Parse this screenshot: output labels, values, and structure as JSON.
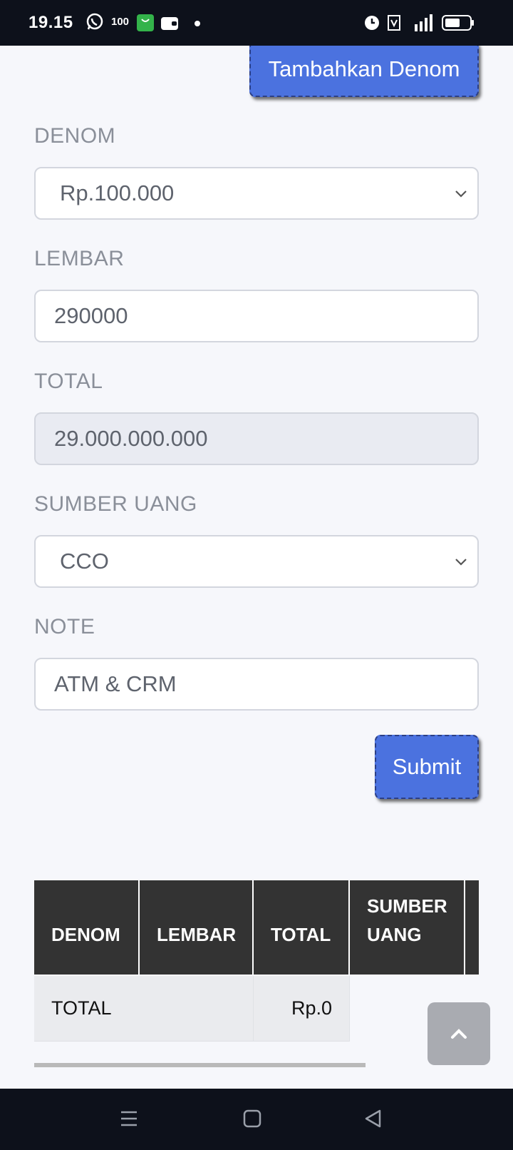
{
  "status_bar": {
    "time": "19.15",
    "battery_saver_text": "100"
  },
  "buttons": {
    "add_denom": "Tambahkan Denom",
    "submit": "Submit"
  },
  "form": {
    "denom": {
      "label": "DENOM",
      "value": "Rp.100.000"
    },
    "lembar": {
      "label": "LEMBAR",
      "value": "290000"
    },
    "total": {
      "label": "TOTAL",
      "value": "29.000.000.000"
    },
    "sumber_uang": {
      "label": "SUMBER UANG",
      "value": "CCO"
    },
    "note": {
      "label": "NOTE",
      "value": "ATM & CRM"
    }
  },
  "table": {
    "headers": [
      "DENOM",
      "LEMBAR",
      "TOTAL",
      "SUMBER UANG"
    ],
    "total_row": {
      "label": "TOTAL",
      "total": "Rp.0"
    }
  },
  "colors": {
    "primary": "#4b72df",
    "header_bg": "#333333",
    "system_bar": "#0d111b"
  }
}
